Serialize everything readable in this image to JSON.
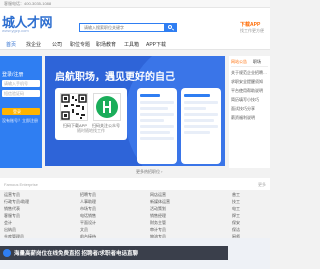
{
  "top_strip": {
    "text": "客服电话：400-3035-1088"
  },
  "header": {
    "logo": "城人才网",
    "logo_sub": "www.ygzp.com",
    "search_placeholder": "请输入搜索职位关键字",
    "app_download": "下载APP",
    "app_download_sub": "找工作更方便"
  },
  "nav": {
    "items": [
      "首页",
      "找企业",
      "公司",
      "职位专题",
      "职场教育",
      "工具箱",
      "APP下载"
    ]
  },
  "login": {
    "title": "登录/注册",
    "phone_placeholder": "请输入手机号",
    "code_placeholder": "短信验证码",
    "login_label": "登录",
    "register_label": "没有账号？立即注册"
  },
  "banner": {
    "headline": "启航职场，遇见更好的自己",
    "qr_label_1": "扫码下载APP",
    "qr_label_2": "扫码关注公众号",
    "qr_note": "随时随地找工作"
  },
  "right_col": {
    "tabs": [
      "网站公告",
      "职场"
    ],
    "items": [
      "关于规范企业招聘…",
      "求职安全提醒须知",
      "平台使用帮助说明",
      "简历填写小技巧",
      "面试技巧分享",
      "薪资福利说明"
    ]
  },
  "hint": {
    "text": "更多热招职位 ›"
  },
  "section2": {
    "title": "Famous Enterprise",
    "more": "更多"
  },
  "jobs": {
    "columns": [
      [
        "运营专员",
        "行政专员/助理",
        "销售代表",
        "客服专员",
        "会计",
        "出纳员",
        "仓库管理员",
        "司机"
      ],
      [
        "招聘专员",
        "人事助理",
        "市场专员",
        "电话销售",
        "平面设计",
        "文员",
        "前台接待",
        "质检员"
      ],
      [
        "网店运营",
        "新媒体运营",
        "活动策划",
        "销售经理",
        "财务主管",
        "审计专员",
        "物流专员",
        "采购员"
      ],
      [
        "普工",
        "技工",
        "电工",
        "焊工",
        "保安",
        "保洁",
        "厨师",
        "服务员"
      ]
    ]
  },
  "download_bar": {
    "text": "海量高薪岗位在线免费直招 招聘者/求职者电话直聊"
  }
}
